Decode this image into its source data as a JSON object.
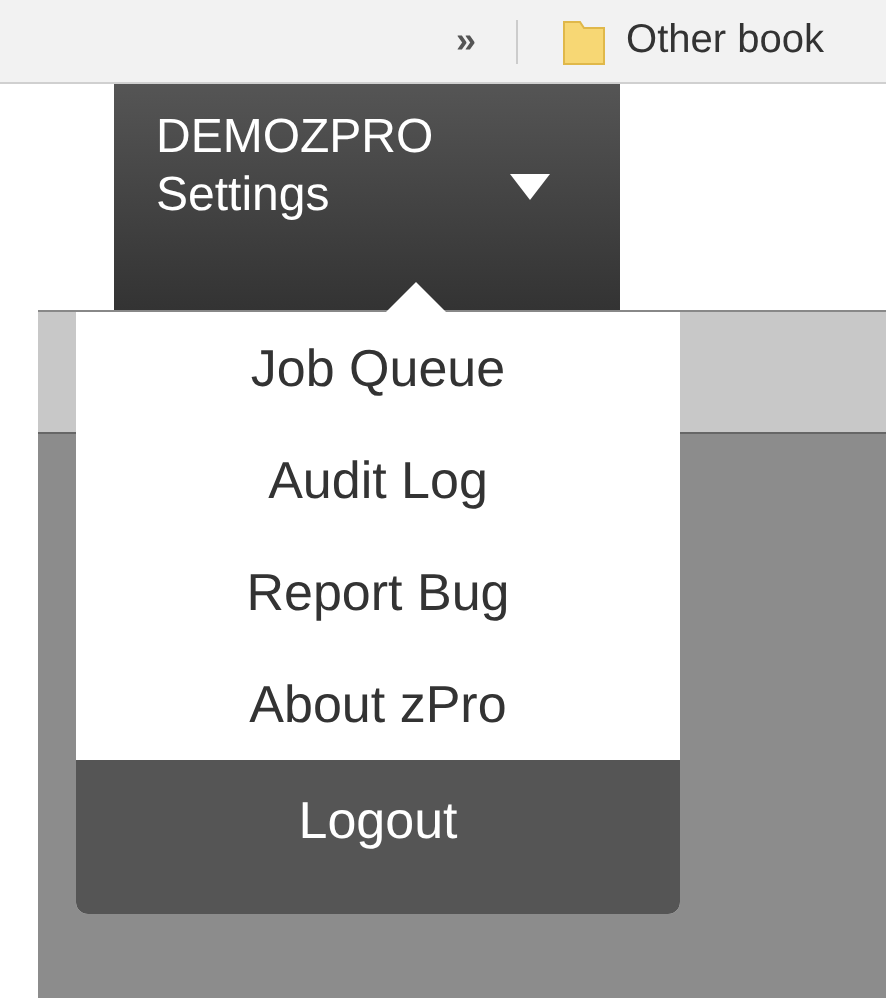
{
  "bookmarks_bar": {
    "overflow": "»",
    "folder": "Other book"
  },
  "account_menu": {
    "name": "DEMOZPRO",
    "label": "Settings",
    "expanded": true
  },
  "dropdown": {
    "items": [
      {
        "label": "Job Queue",
        "kind": "item"
      },
      {
        "label": "Audit Log",
        "kind": "item"
      },
      {
        "label": "Report Bug",
        "kind": "item"
      },
      {
        "label": "About zPro",
        "kind": "item"
      },
      {
        "label": "Logout",
        "kind": "logout"
      }
    ]
  }
}
